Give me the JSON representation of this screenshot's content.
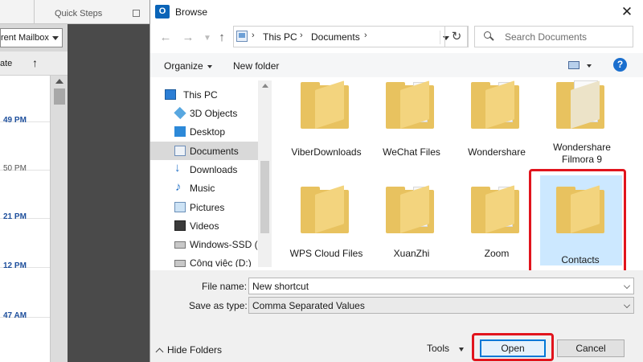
{
  "background_app": {
    "quick_steps_label": "Quick Steps",
    "mailbox_scope": "rent Mailbox",
    "sort_label": "ate",
    "sort_arrow": "↑",
    "mail_times": [
      "49 PM",
      "50 PM",
      "21 PM",
      "12 PM",
      "47 AM"
    ]
  },
  "dialog": {
    "title": "Browse",
    "close_glyph": "✕",
    "nav": {
      "back": "←",
      "forward": "→",
      "up": "↑"
    },
    "address": {
      "crumbs": [
        "This PC",
        "Documents"
      ],
      "separator": "›"
    },
    "refresh_glyph": "↻",
    "search_placeholder": "Search Documents",
    "toolbar": {
      "organize": "Organize",
      "new_folder": "New folder",
      "help": "?"
    },
    "nav_pane": {
      "items": [
        {
          "label": "This PC",
          "icon": "computer-icon"
        },
        {
          "label": "3D Objects",
          "icon": "3d-objects-icon"
        },
        {
          "label": "Desktop",
          "icon": "desktop-icon"
        },
        {
          "label": "Documents",
          "icon": "documents-icon",
          "selected": true
        },
        {
          "label": "Downloads",
          "icon": "downloads-icon"
        },
        {
          "label": "Music",
          "icon": "music-icon"
        },
        {
          "label": "Pictures",
          "icon": "pictures-icon"
        },
        {
          "label": "Videos",
          "icon": "videos-icon"
        },
        {
          "label": "Windows-SSD (C",
          "icon": "drive-icon"
        },
        {
          "label": "Công việc (D:)",
          "icon": "drive-icon"
        }
      ]
    },
    "folders": [
      {
        "name": "ViberDownloads"
      },
      {
        "name": "WeChat Files"
      },
      {
        "name": "Wondershare"
      },
      {
        "name": "Wondershare Filmora 9"
      },
      {
        "name": "WPS Cloud Files"
      },
      {
        "name": "XuanZhi"
      },
      {
        "name": "Zoom"
      },
      {
        "name": "Contacts",
        "selected": true
      }
    ],
    "file_name": {
      "label": "File name:",
      "value": "New shortcut"
    },
    "save_as_type": {
      "label": "Save as type:",
      "value": "Comma Separated Values"
    },
    "hide_folders": "Hide Folders",
    "tools": "Tools",
    "open": "Open",
    "cancel": "Cancel",
    "highlight_color": "#e1141d",
    "selection_color": "#cce8ff",
    "folder_color": "#e8c25f"
  }
}
